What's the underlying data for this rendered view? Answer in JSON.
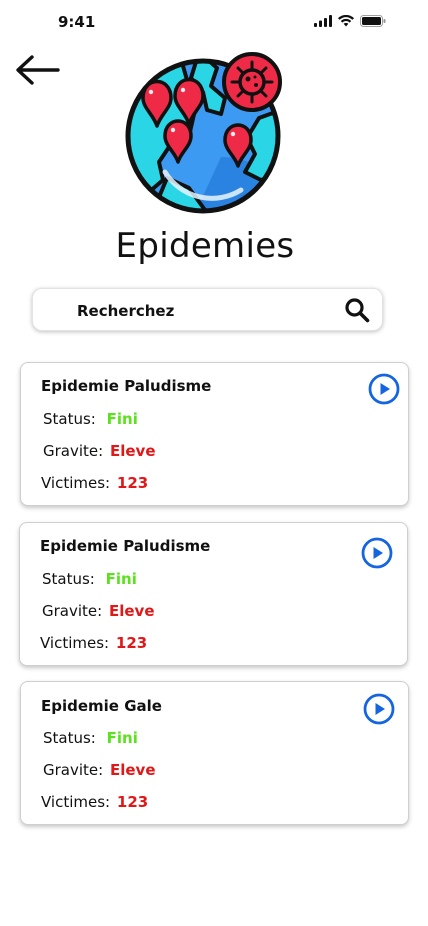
{
  "status_bar": {
    "time": "9:41"
  },
  "page": {
    "title": "Epidemies"
  },
  "search": {
    "placeholder": "Recherchez"
  },
  "labels": {
    "status": "Status:",
    "gravite": "Gravite:",
    "victimes": "Victimes:"
  },
  "colors": {
    "status_value": "#5ce21c",
    "danger_value": "#e01818",
    "accent": "#1565e0"
  },
  "epidemics": [
    {
      "name": "Epidemie Paludisme",
      "status": "Fini",
      "gravite": "Eleve",
      "victimes": "123"
    },
    {
      "name": "Epidemie Paludisme",
      "status": "Fini",
      "gravite": "Eleve",
      "victimes": "123"
    },
    {
      "name": "Epidemie Gale",
      "status": "Fini",
      "gravite": "Eleve",
      "victimes": "123"
    }
  ]
}
